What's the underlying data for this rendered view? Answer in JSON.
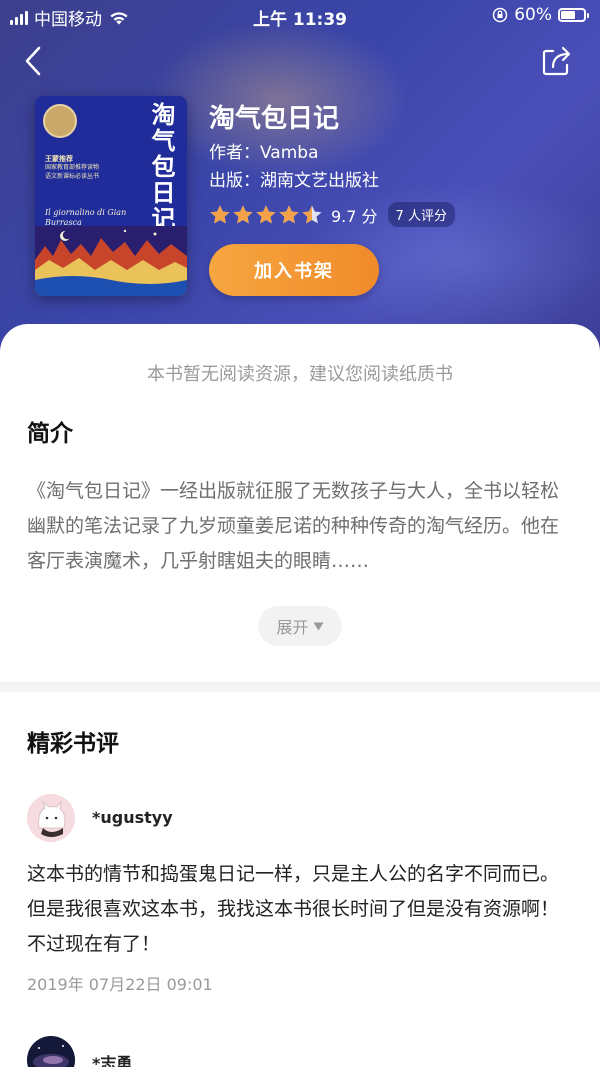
{
  "status_bar": {
    "carrier": "中国移动",
    "time": "上午 11:39",
    "battery": "60%"
  },
  "book": {
    "title": "淘气包日记",
    "author_label": "作者：",
    "author": "Vamba",
    "publisher_label": "出版：",
    "publisher": "湖南文艺出版社",
    "rating_stars": 4.5,
    "score": "9.7 分",
    "rating_count": "7 人评分",
    "add_button": "加入书架",
    "cover": {
      "title": "淘气包日记",
      "subtitle_lines": [
        "王蒙推荐",
        "国家教育部推荐读物",
        "语文新课标必读丛书"
      ],
      "italic_title": "Il giornalino di Gian Burrasca"
    }
  },
  "notice": "本书暂无阅读资源，建议您阅读纸质书",
  "intro": {
    "heading": "简介",
    "text": "《淘气包日记》一经出版就征服了无数孩子与大人，全书以轻松幽默的笔法记录了九岁顽童姜尼诺的种种传奇的淘气经历。他在客厅表演魔术，几乎射瞎姐夫的眼睛……",
    "expand_label": "展开"
  },
  "reviews": {
    "heading": "精彩书评",
    "items": [
      {
        "user": "*ugustyy",
        "text": "这本书的情节和捣蛋鬼日记一样，只是主人公的名字不同而已。但是我很喜欢这本书，我找这本书很长时间了但是没有资源啊！不过现在有了！",
        "date": "2019年 07月22日 09:01"
      },
      {
        "user": "*志勇"
      }
    ]
  },
  "colors": {
    "hero_bg": "#3a45a8",
    "accent_orange": "#f08a2a",
    "star": "#f3a24a"
  }
}
